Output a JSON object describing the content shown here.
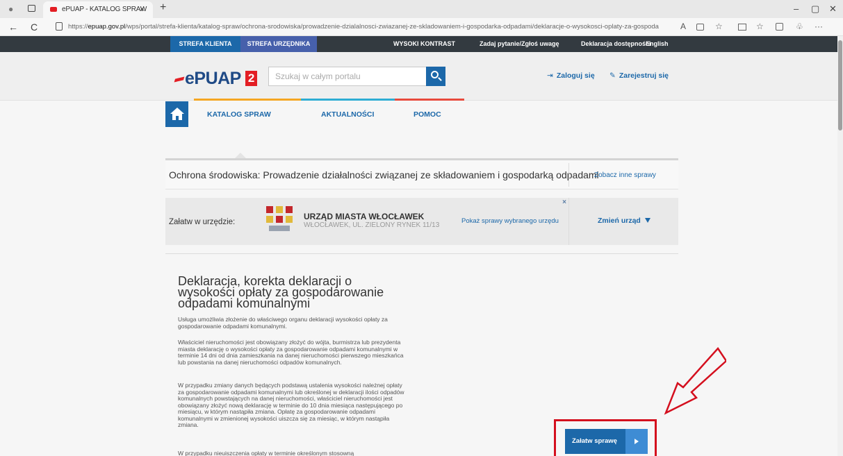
{
  "browser": {
    "tab_title": "ePUAP - KATALOG SPRAW",
    "tab_close": "×",
    "new_tab": "+",
    "url_prefix": "https://",
    "url_domain": "epuap.gov.pl",
    "url_path": "/wps/portal/strefa-klienta/katalog-spraw/ochrona-srodowiska/prowadzenie-dzialalnosci-zwiazanej-ze-skladowaniem-i-gospodarka-odpadami/deklaracje-o-wysokosci-oplaty-za-gospodarowanie-odpa...",
    "back": "←",
    "refresh": "C",
    "minimize": "–",
    "restore": "▢",
    "close": "✕",
    "more": "···",
    "read_aloud": "A",
    "favorites": "☆"
  },
  "topbar": {
    "zone_client": "STREFA KLIENTA",
    "zone_official": "STREFA URZĘDNIKA",
    "high_contrast": "WYSOKI KONTRAST",
    "ask": "Zadaj pytanie/Zgłoś uwagę",
    "accessibility": "Deklaracja dostępności",
    "english": "English"
  },
  "header": {
    "logo_text": "ePUAP",
    "logo_badge": "2",
    "search_placeholder": "Szukaj w całym portalu",
    "login": "Zaloguj się",
    "register": "Zarejestruj się",
    "login_icon": "⇥",
    "register_icon": "✎"
  },
  "nav": {
    "catalog": "KATALOG SPRAW",
    "news": "AKTUALNOŚCI",
    "help": "POMOC"
  },
  "category": {
    "text": "Ochrona środowiska: Prowadzenie działalności związanej ze składowaniem i gospodarką odpadami",
    "other_link": "Zobacz inne sprawy"
  },
  "office": {
    "label": "Załatw w urzędzie:",
    "name": "URZĄD MIASTA WŁOCŁAWEK",
    "address": "WŁOCŁAWEK, UL. ZIELONY RYNEK 11/13",
    "show_link": "Pokaż sprawy wybranego urzędu",
    "close": "×",
    "change": "Zmień urząd"
  },
  "service": {
    "title": "Deklaracja, korekta deklaracji o wysokości opłaty za gospodarowanie odpadami komunalnymi",
    "paragraphs": [
      "Usługa umożliwia złożenie do właściwego organu deklaracji wysokości opłaty za gospodarowanie odpadami komunalnymi.",
      "Właściciel nieruchomości jest obowiązany złożyć do wójta, burmistrza lub prezydenta miasta deklarację o wysokości opłaty za gospodarowanie odpadami komunalnymi w terminie 14 dni od dnia zamieszkania na danej nieruchomości pierwszego mieszkańca lub powstania na danej nieruchomości odpadów komunalnych.",
      "W przypadku zmiany danych będących podstawą ustalenia wysokości należnej opłaty za gospodarowanie odpadami komunalnymi lub określonej w deklaracji ilości odpadów komunalnych powstających na danej nieruchomości, właściciel nieruchomości jest obowiązany złożyć nową deklarację w terminie do 10 dnia miesiąca następującego po miesiącu, w którym nastąpiła zmiana. Opłatę za gospodarowanie odpadami komunalnymi w zmienionej wysokości uiszcza się za miesiąc, w którym nastąpiła zmiana.",
      "W przypadku nieuiszczenia opłaty w terminie określonym stosowną"
    ],
    "action_button": "Załatw sprawę"
  },
  "colors": {
    "primary": "#1c68a9",
    "top_strip": "#333a40",
    "annotation_red": "#d40f1e"
  }
}
